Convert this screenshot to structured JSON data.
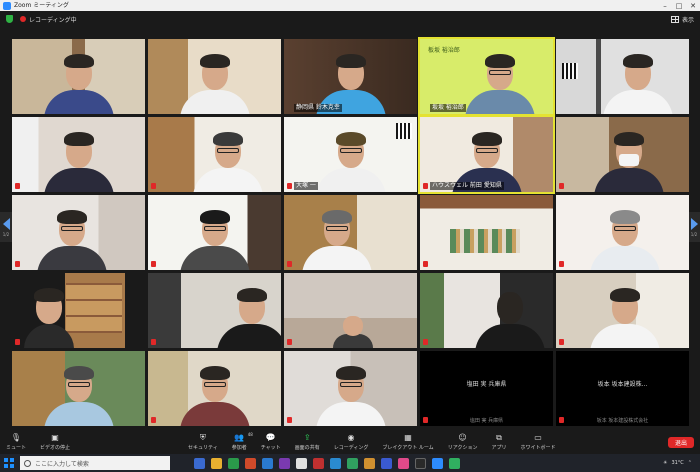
{
  "window": {
    "title": "Zoom ミーティング"
  },
  "top": {
    "recording_label": "レコーディング中",
    "view_label": "表示"
  },
  "pager": {
    "left_page": "1/2",
    "right_page": "1/2"
  },
  "tiles": [
    {
      "name": "",
      "mic_muted": false
    },
    {
      "name": "",
      "mic_muted": false
    },
    {
      "name": "静岡県 鈴木克幸",
      "mic_muted": false
    },
    {
      "name": "坂坂 裕治郎",
      "mic_muted": false,
      "banner": "板坂 裕治郎"
    },
    {
      "name": "",
      "mic_muted": false
    },
    {
      "name": "",
      "mic_muted": true
    },
    {
      "name": "",
      "mic_muted": true
    },
    {
      "name": "大塚 一",
      "mic_muted": true
    },
    {
      "name": "ハウスウェル 前田 愛知県",
      "mic_muted": true
    },
    {
      "name": "",
      "mic_muted": true
    },
    {
      "name": "",
      "mic_muted": true
    },
    {
      "name": "",
      "mic_muted": true
    },
    {
      "name": "",
      "mic_muted": true
    },
    {
      "name": "",
      "mic_muted": true
    },
    {
      "name": "",
      "mic_muted": true
    },
    {
      "name": "",
      "mic_muted": true
    },
    {
      "name": "",
      "mic_muted": true
    },
    {
      "name": "",
      "mic_muted": true
    },
    {
      "name": "",
      "mic_muted": true
    },
    {
      "name": "",
      "mic_muted": true
    },
    {
      "name": "",
      "mic_muted": false
    },
    {
      "name": "",
      "mic_muted": true
    },
    {
      "name": "",
      "mic_muted": true
    },
    {
      "center_name": "塩田 実 兵庫県",
      "sub_name": "塩田 実 兵庫県",
      "mic_muted": true
    },
    {
      "center_name": "坂本 坂本建設株...",
      "sub_name": "坂本 坂本建設株式会社",
      "mic_muted": true
    }
  ],
  "toolbar": {
    "mute": "ミュート",
    "video": "ビデオの停止",
    "security": "セキュリティ",
    "participants": "参加者",
    "participants_count": "48",
    "chat": "チャット",
    "share": "画面の共有",
    "record": "レコーディング",
    "breakout": "ブレイクアウト ルーム",
    "reactions": "リアクション",
    "apps": "アプリ",
    "whiteboard": "ホワイトボード",
    "leave": "退出"
  },
  "taskbar": {
    "search_placeholder": "ここに入力して検索",
    "weather": "31°C",
    "time": "",
    "date": ""
  },
  "colors": {
    "accent": "#2d8cff",
    "leave": "#e02828",
    "active_speaker": "#e4e232",
    "share": "#2fd15c"
  }
}
